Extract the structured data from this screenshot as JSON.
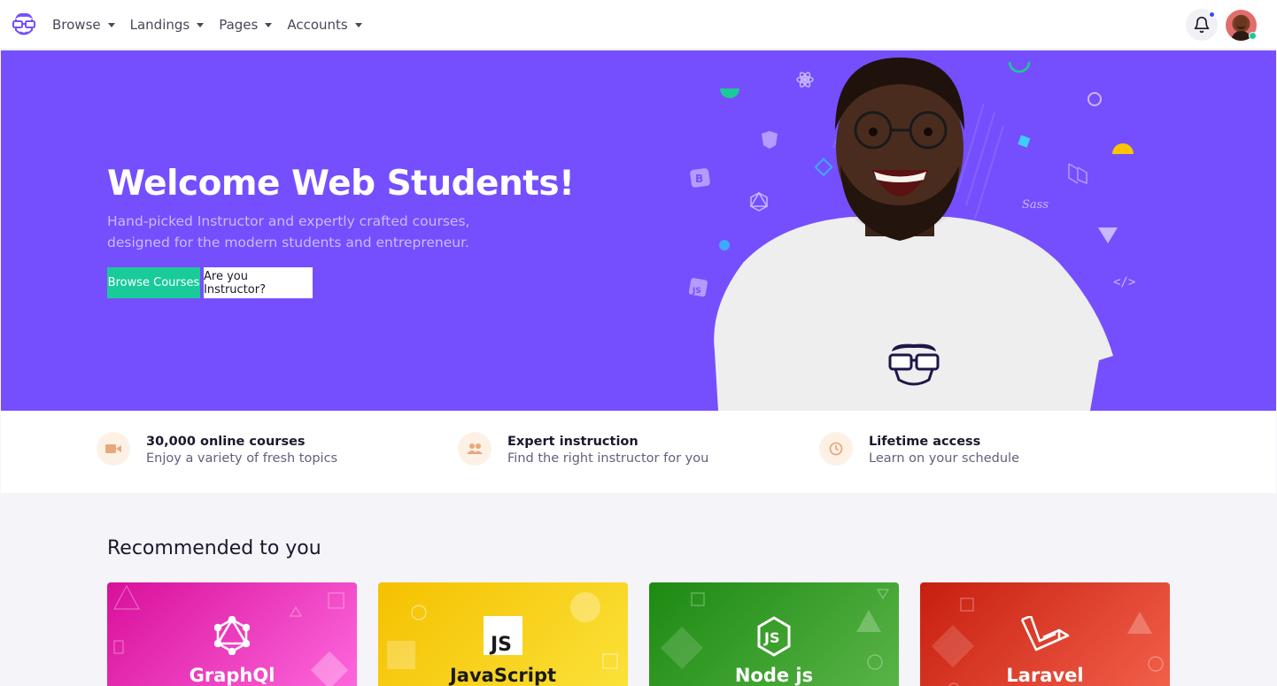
{
  "navbar": {
    "brand_icon": "geek-face-logo-icon",
    "items": [
      {
        "label": "Browse"
      },
      {
        "label": "Landings"
      },
      {
        "label": "Pages"
      },
      {
        "label": "Accounts"
      }
    ],
    "notification_icon": "bell-icon",
    "has_unread": true,
    "user_online": true
  },
  "hero": {
    "title": "Welcome Web Students!",
    "subtitle": "Hand-picked Instructor and expertly crafted courses, designed for the modern students and entrepreneur.",
    "primary_button": "Browse Courses",
    "secondary_button": "Are you Instructor?",
    "background_color": "#754ffe",
    "floating_tech_icons": [
      "react-icon",
      "angular-icon",
      "bootstrap-icon",
      "graphql-icon",
      "javascript-icon",
      "laravel-icon",
      "sass-icon",
      "vue-icon",
      "code-icon",
      "gatsby-icon"
    ]
  },
  "features": [
    {
      "icon": "video-icon",
      "title": "30,000 online courses",
      "description": "Enjoy a variety of fresh topics"
    },
    {
      "icon": "users-icon",
      "title": "Expert instruction",
      "description": "Find the right instructor for you"
    },
    {
      "icon": "clock-icon",
      "title": "Lifetime access",
      "description": "Learn on your schedule"
    }
  ],
  "recommended": {
    "title": "Recommended to you",
    "cards": [
      {
        "title": "GraphQl",
        "icon": "graphql-icon",
        "color": "#e32ca4"
      },
      {
        "title": "JavaScript",
        "icon": "javascript-icon",
        "color": "#f5c800"
      },
      {
        "title": "Node js",
        "icon": "nodejs-icon",
        "color": "#2e8b1c"
      },
      {
        "title": "Laravel",
        "icon": "laravel-icon",
        "color": "#e2361e"
      }
    ]
  }
}
